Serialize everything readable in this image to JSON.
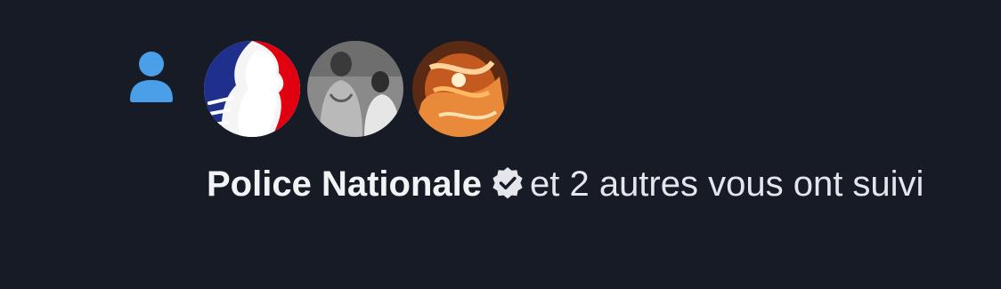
{
  "notification": {
    "type_icon": "person-icon",
    "avatars": [
      {
        "icon": "marianne-logo-avatar"
      },
      {
        "icon": "photo-avatar"
      },
      {
        "icon": "photo-avatar"
      }
    ],
    "actor_name": "Police Nationale",
    "verified_icon": "verified-badge-icon",
    "message_rest": "et 2 autres vous ont suivi"
  },
  "colors": {
    "background": "#161b26",
    "icon_blue": "#4a9fe8",
    "text": "#e4e6eb"
  }
}
